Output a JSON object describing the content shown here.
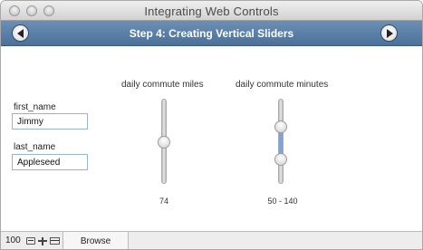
{
  "window": {
    "title": "Integrating Web Controls"
  },
  "header": {
    "title": "Step 4: Creating Vertical Sliders"
  },
  "form": {
    "first_name_label": "first_name",
    "first_name_value": "Jimmy",
    "last_name_label": "last_name",
    "last_name_value": "Appleseed"
  },
  "sliders": {
    "miles": {
      "label": "daily commute miles",
      "value_text": "74",
      "min": 0,
      "max": 150,
      "value": 74
    },
    "minutes": {
      "label": "daily commute minutes",
      "range_text": "50  -  140",
      "min": 0,
      "max": 200,
      "low": 50,
      "high": 140
    }
  },
  "colors": {
    "header_bg": "#5a7fa8",
    "range_fill": "#7ba4d9"
  },
  "status": {
    "zoom": "100",
    "mode": "Browse"
  },
  "icons": [
    "zoom-out-icon",
    "zoom-in-icon",
    "layout-toggle-icon",
    "back-arrow-icon",
    "forward-arrow-icon"
  ]
}
